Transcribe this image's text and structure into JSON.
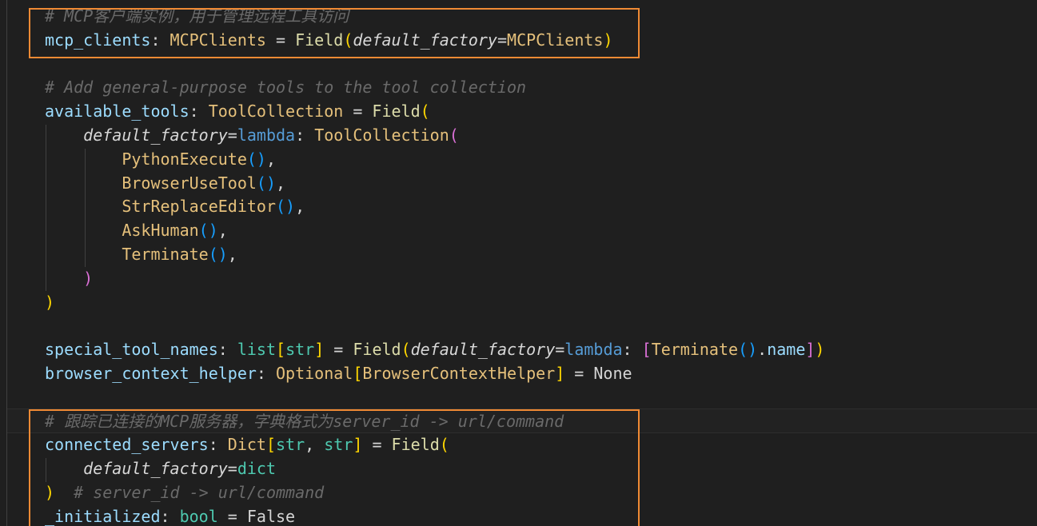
{
  "editor": {
    "lines": [
      {
        "id": "l0",
        "tokens": [
          [
            "cmt",
            "# MCP客户端实例，用于管理远程工具访问"
          ]
        ]
      },
      {
        "id": "l1",
        "tokens": [
          [
            "var",
            "mcp_clients"
          ],
          [
            "pun",
            ": "
          ],
          [
            "cls",
            "MCPClients"
          ],
          [
            "op",
            " = "
          ],
          [
            "fn",
            "Field"
          ],
          [
            "b1",
            "("
          ],
          [
            "param",
            "default_factory"
          ],
          [
            "op",
            "="
          ],
          [
            "cls",
            "MCPClients"
          ],
          [
            "b1",
            ")"
          ]
        ]
      },
      {
        "id": "l2",
        "tokens": []
      },
      {
        "id": "l3",
        "tokens": [
          [
            "cmt",
            "# Add general-purpose tools to the tool collection"
          ]
        ]
      },
      {
        "id": "l4",
        "tokens": [
          [
            "var",
            "available_tools"
          ],
          [
            "pun",
            ": "
          ],
          [
            "cls",
            "ToolCollection"
          ],
          [
            "op",
            " = "
          ],
          [
            "fn",
            "Field"
          ],
          [
            "b1",
            "("
          ]
        ]
      },
      {
        "id": "l5",
        "tokens": [
          [
            "pun",
            "    "
          ],
          [
            "param",
            "default_factory"
          ],
          [
            "op",
            "="
          ],
          [
            "kw",
            "lambda"
          ],
          [
            "pun",
            ": "
          ],
          [
            "cls",
            "ToolCollection"
          ],
          [
            "b2",
            "("
          ]
        ]
      },
      {
        "id": "l6",
        "tokens": [
          [
            "pun",
            "        "
          ],
          [
            "cls",
            "PythonExecute"
          ],
          [
            "b3",
            "()"
          ],
          [
            "pun",
            ","
          ]
        ]
      },
      {
        "id": "l7",
        "tokens": [
          [
            "pun",
            "        "
          ],
          [
            "cls",
            "BrowserUseTool"
          ],
          [
            "b3",
            "()"
          ],
          [
            "pun",
            ","
          ]
        ]
      },
      {
        "id": "l8",
        "tokens": [
          [
            "pun",
            "        "
          ],
          [
            "cls",
            "StrReplaceEditor"
          ],
          [
            "b3",
            "()"
          ],
          [
            "pun",
            ","
          ]
        ]
      },
      {
        "id": "l9",
        "tokens": [
          [
            "pun",
            "        "
          ],
          [
            "cls",
            "AskHuman"
          ],
          [
            "b3",
            "()"
          ],
          [
            "pun",
            ","
          ]
        ]
      },
      {
        "id": "l10",
        "tokens": [
          [
            "pun",
            "        "
          ],
          [
            "cls",
            "Terminate"
          ],
          [
            "b3",
            "()"
          ],
          [
            "pun",
            ","
          ]
        ]
      },
      {
        "id": "l11",
        "tokens": [
          [
            "pun",
            "    "
          ],
          [
            "b2",
            ")"
          ]
        ]
      },
      {
        "id": "l12",
        "tokens": [
          [
            "b1",
            ")"
          ]
        ]
      },
      {
        "id": "l13",
        "tokens": []
      },
      {
        "id": "l14",
        "tokens": [
          [
            "var",
            "special_tool_names"
          ],
          [
            "pun",
            ": "
          ],
          [
            "builtin",
            "list"
          ],
          [
            "b1",
            "["
          ],
          [
            "builtin",
            "str"
          ],
          [
            "b1",
            "]"
          ],
          [
            "op",
            " = "
          ],
          [
            "fn",
            "Field"
          ],
          [
            "b1",
            "("
          ],
          [
            "param",
            "default_factory"
          ],
          [
            "op",
            "="
          ],
          [
            "kw",
            "lambda"
          ],
          [
            "pun",
            ": "
          ],
          [
            "b2",
            "["
          ],
          [
            "cls",
            "Terminate"
          ],
          [
            "b3",
            "()"
          ],
          [
            "pun",
            "."
          ],
          [
            "attr",
            "name"
          ],
          [
            "b2",
            "]"
          ],
          [
            "b1",
            ")"
          ]
        ]
      },
      {
        "id": "l15",
        "tokens": [
          [
            "var",
            "browser_context_helper"
          ],
          [
            "pun",
            ": "
          ],
          [
            "cls",
            "Optional"
          ],
          [
            "b1",
            "["
          ],
          [
            "cls",
            "BrowserContextHelper"
          ],
          [
            "b1",
            "]"
          ],
          [
            "op",
            " = "
          ],
          [
            "const",
            "None"
          ]
        ]
      },
      {
        "id": "l16",
        "tokens": []
      },
      {
        "id": "l17",
        "tokens": [
          [
            "cmt",
            "# 跟踪已连接的MCP服务器，字典格式为server_id -> url/command"
          ]
        ]
      },
      {
        "id": "l18",
        "tokens": [
          [
            "var",
            "connected_servers"
          ],
          [
            "pun",
            ": "
          ],
          [
            "cls",
            "Dict"
          ],
          [
            "b1",
            "["
          ],
          [
            "builtin",
            "str"
          ],
          [
            "pun",
            ", "
          ],
          [
            "builtin",
            "str"
          ],
          [
            "b1",
            "]"
          ],
          [
            "op",
            " = "
          ],
          [
            "fn",
            "Field"
          ],
          [
            "b1",
            "("
          ]
        ]
      },
      {
        "id": "l19",
        "tokens": [
          [
            "pun",
            "    "
          ],
          [
            "param",
            "default_factory"
          ],
          [
            "op",
            "="
          ],
          [
            "builtin",
            "dict"
          ]
        ]
      },
      {
        "id": "l20",
        "tokens": [
          [
            "b1",
            ")"
          ],
          [
            "pun",
            "  "
          ],
          [
            "cmt",
            "# server_id -> url/command"
          ]
        ]
      },
      {
        "id": "l21",
        "tokens": [
          [
            "var",
            "_initialized"
          ],
          [
            "pun",
            ": "
          ],
          [
            "builtin",
            "bool"
          ],
          [
            "op",
            " = "
          ],
          [
            "const",
            "False"
          ]
        ]
      }
    ],
    "highlight_color": "#f08a34"
  }
}
